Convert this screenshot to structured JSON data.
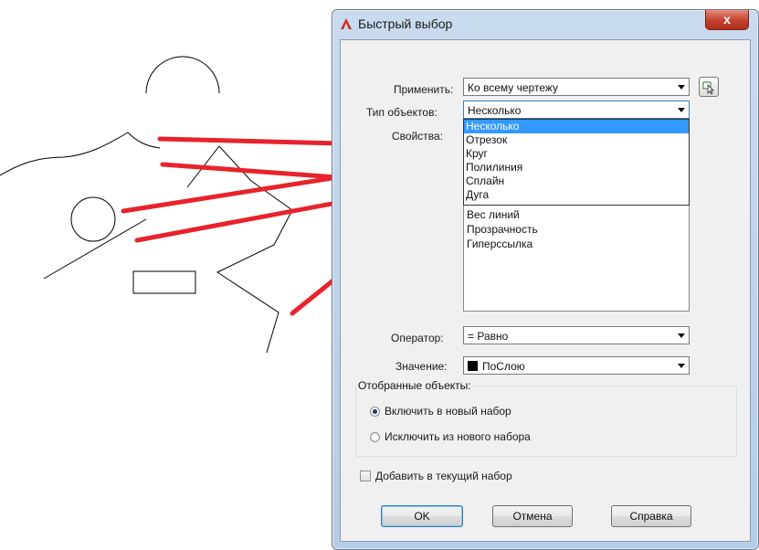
{
  "window": {
    "title": "Быстрый выбор",
    "close_glyph": "x"
  },
  "form": {
    "apply_label": "Применить:",
    "apply_value": "Ко всему чертежу",
    "object_type_label": "Тип объектов:",
    "object_type_value": "Несколько",
    "properties_label": "Свойства:",
    "properties_items": [
      "Вес линий",
      "Прозрачность",
      "Гиперссылка"
    ],
    "dropdown_items": [
      "Несколько",
      "Отрезок",
      "Круг",
      "Полилиния",
      "Сплайн",
      "Дуга"
    ],
    "operator_label": "Оператор:",
    "operator_value": "= Равно",
    "value_label": "Значение:",
    "value_value": "ПоСлою"
  },
  "group": {
    "title": "Отобранные объекты:",
    "include": "Включить в новый набор",
    "exclude": "Исключить из нового набора"
  },
  "append_label": "Добавить в текущий набор",
  "buttons": {
    "ok": "OK",
    "cancel": "Отмена",
    "help": "Справка"
  },
  "colors": {
    "arrow": "#e8232b",
    "selection": "#3399ff"
  },
  "icons": {
    "app": "autocad-logo-icon",
    "select": "select-objects-icon"
  }
}
